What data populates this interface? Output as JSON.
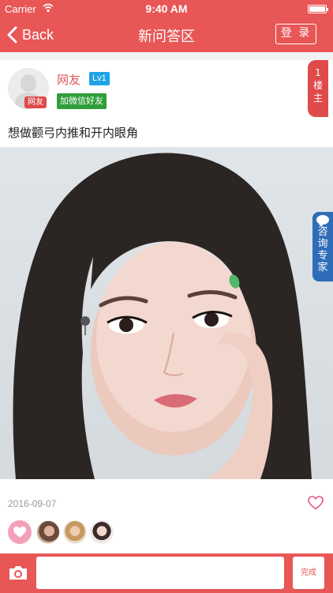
{
  "status_bar": {
    "carrier": "Carrier",
    "time": "9:40 AM"
  },
  "nav": {
    "back_label": "Back",
    "title": "新问答区",
    "login_label": "登 录"
  },
  "post": {
    "author": "网友",
    "avatar_badge": "网友",
    "level": "Lv1",
    "wechat_button": "加微信好友",
    "floor": [
      "1",
      "楼",
      "主"
    ],
    "question": "想做颧弓内推和开内眼角",
    "date": "2016-09-07"
  },
  "consult_tab": {
    "chars": [
      "咨",
      "询",
      "专",
      "家"
    ]
  },
  "likers": [
    {
      "name": "liker-1"
    },
    {
      "name": "liker-2"
    },
    {
      "name": "liker-3"
    }
  ],
  "composer": {
    "input_value": "",
    "input_placeholder": "",
    "done_label": "完成"
  },
  "colors": {
    "brand": "#e85656",
    "level_badge": "#1ea3e6",
    "wechat": "#2f9e3a",
    "consult": "#2f6db8",
    "like": "#f4a0b8"
  },
  "icons": [
    "back-chevron-icon",
    "wifi-icon",
    "battery-icon",
    "heart-outline-icon",
    "heart-filled-icon",
    "camera-icon",
    "chat-bubble-icon"
  ]
}
